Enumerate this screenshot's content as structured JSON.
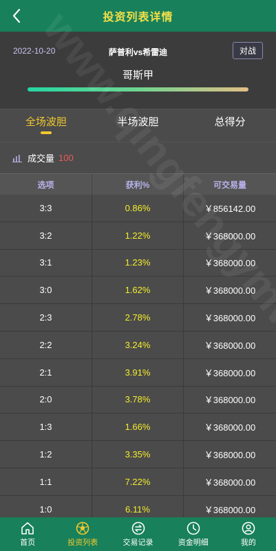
{
  "header": {
    "title": "投资列表详情",
    "back_icon": "chevron-left-icon"
  },
  "match": {
    "date": "2022-10-20",
    "teams": "萨普利vs希雷迪",
    "action_label": "对战",
    "league": "哥斯甲"
  },
  "tabs": [
    {
      "label": "全场波胆",
      "active": true
    },
    {
      "label": "半场波胆",
      "active": false
    },
    {
      "label": "总得分",
      "active": false
    }
  ],
  "volume": {
    "label": "成交量",
    "value": "100",
    "icon": "bar-chart-icon"
  },
  "table": {
    "columns": [
      "选项",
      "获利%",
      "可交易量"
    ],
    "rows": [
      {
        "option": "3:3",
        "profit": "0.86%",
        "amount": "￥856142.00"
      },
      {
        "option": "3:2",
        "profit": "1.22%",
        "amount": "￥368000.00"
      },
      {
        "option": "3:1",
        "profit": "1.23%",
        "amount": "￥368000.00"
      },
      {
        "option": "3:0",
        "profit": "1.62%",
        "amount": "￥368000.00"
      },
      {
        "option": "2:3",
        "profit": "2.78%",
        "amount": "￥368000.00"
      },
      {
        "option": "2:2",
        "profit": "3.24%",
        "amount": "￥368000.00"
      },
      {
        "option": "2:1",
        "profit": "3.91%",
        "amount": "￥368000.00"
      },
      {
        "option": "2:0",
        "profit": "3.78%",
        "amount": "￥368000.00"
      },
      {
        "option": "1:3",
        "profit": "1.66%",
        "amount": "￥368000.00"
      },
      {
        "option": "1:2",
        "profit": "3.35%",
        "amount": "￥368000.00"
      },
      {
        "option": "1:1",
        "profit": "7.22%",
        "amount": "￥368000.00"
      },
      {
        "option": "1:0",
        "profit": "6.11%",
        "amount": "￥368000.00"
      }
    ]
  },
  "watermark": "www.qingfengymw.cn 清风源码",
  "nav": [
    {
      "label": "首页",
      "icon": "home-icon",
      "active": false
    },
    {
      "label": "投资列表",
      "icon": "football-icon",
      "active": true
    },
    {
      "label": "交易记录",
      "icon": "exchange-icon",
      "active": false
    },
    {
      "label": "资金明细",
      "icon": "clock-icon",
      "active": false
    },
    {
      "label": "我的",
      "icon": "user-icon",
      "active": false
    }
  ],
  "colors": {
    "primary": "#18805a",
    "accent": "#f0c830",
    "profit": "#f5ed2c",
    "volume_value": "#ec5a5a"
  }
}
